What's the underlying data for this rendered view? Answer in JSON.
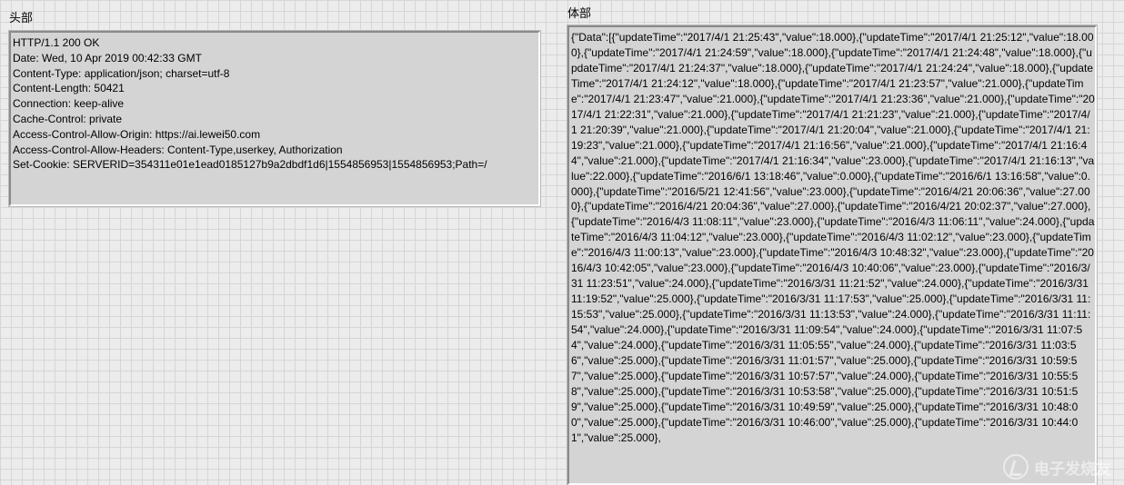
{
  "header_panel": {
    "label": "头部",
    "lines": [
      "HTTP/1.1 200 OK",
      "Date: Wed, 10 Apr 2019 00:42:33 GMT",
      "Content-Type: application/json; charset=utf-8",
      "Content-Length: 50421",
      "Connection: keep-alive",
      "Cache-Control: private",
      "Access-Control-Allow-Origin: https://ai.lewei50.com",
      "Access-Control-Allow-Headers: Content-Type,userkey, Authorization",
      "Set-Cookie: SERVERID=354311e01e1ead0185127b9a2dbdf1d6|1554856953|1554856953;Path=/"
    ]
  },
  "body_panel": {
    "label": "体部",
    "text": "{\"Data\":[{\"updateTime\":\"2017/4/1 21:25:43\",\"value\":18.000},{\"updateTime\":\"2017/4/1 21:25:12\",\"value\":18.000},{\"updateTime\":\"2017/4/1 21:24:59\",\"value\":18.000},{\"updateTime\":\"2017/4/1 21:24:48\",\"value\":18.000},{\"updateTime\":\"2017/4/1 21:24:37\",\"value\":18.000},{\"updateTime\":\"2017/4/1 21:24:24\",\"value\":18.000},{\"updateTime\":\"2017/4/1 21:24:12\",\"value\":18.000},{\"updateTime\":\"2017/4/1 21:23:57\",\"value\":21.000},{\"updateTime\":\"2017/4/1 21:23:47\",\"value\":21.000},{\"updateTime\":\"2017/4/1 21:23:36\",\"value\":21.000},{\"updateTime\":\"2017/4/1 21:22:31\",\"value\":21.000},{\"updateTime\":\"2017/4/1 21:21:23\",\"value\":21.000},{\"updateTime\":\"2017/4/1 21:20:39\",\"value\":21.000},{\"updateTime\":\"2017/4/1 21:20:04\",\"value\":21.000},{\"updateTime\":\"2017/4/1 21:19:23\",\"value\":21.000},{\"updateTime\":\"2017/4/1 21:16:56\",\"value\":21.000},{\"updateTime\":\"2017/4/1 21:16:44\",\"value\":21.000},{\"updateTime\":\"2017/4/1 21:16:34\",\"value\":23.000},{\"updateTime\":\"2017/4/1 21:16:13\",\"value\":22.000},{\"updateTime\":\"2016/6/1 13:18:46\",\"value\":0.000},{\"updateTime\":\"2016/6/1 13:16:58\",\"value\":0.000},{\"updateTime\":\"2016/5/21 12:41:56\",\"value\":23.000},{\"updateTime\":\"2016/4/21 20:06:36\",\"value\":27.000},{\"updateTime\":\"2016/4/21 20:04:36\",\"value\":27.000},{\"updateTime\":\"2016/4/21 20:02:37\",\"value\":27.000},{\"updateTime\":\"2016/4/3 11:08:11\",\"value\":23.000},{\"updateTime\":\"2016/4/3 11:06:11\",\"value\":24.000},{\"updateTime\":\"2016/4/3 11:04:12\",\"value\":23.000},{\"updateTime\":\"2016/4/3 11:02:12\",\"value\":23.000},{\"updateTime\":\"2016/4/3 11:00:13\",\"value\":23.000},{\"updateTime\":\"2016/4/3 10:48:32\",\"value\":23.000},{\"updateTime\":\"2016/4/3 10:42:05\",\"value\":23.000},{\"updateTime\":\"2016/4/3 10:40:06\",\"value\":23.000},{\"updateTime\":\"2016/3/31 11:23:51\",\"value\":24.000},{\"updateTime\":\"2016/3/31 11:21:52\",\"value\":24.000},{\"updateTime\":\"2016/3/31 11:19:52\",\"value\":25.000},{\"updateTime\":\"2016/3/31 11:17:53\",\"value\":25.000},{\"updateTime\":\"2016/3/31 11:15:53\",\"value\":25.000},{\"updateTime\":\"2016/3/31 11:13:53\",\"value\":24.000},{\"updateTime\":\"2016/3/31 11:11:54\",\"value\":24.000},{\"updateTime\":\"2016/3/31 11:09:54\",\"value\":24.000},{\"updateTime\":\"2016/3/31 11:07:54\",\"value\":24.000},{\"updateTime\":\"2016/3/31 11:05:55\",\"value\":24.000},{\"updateTime\":\"2016/3/31 11:03:56\",\"value\":25.000},{\"updateTime\":\"2016/3/31 11:01:57\",\"value\":25.000},{\"updateTime\":\"2016/3/31 10:59:57\",\"value\":25.000},{\"updateTime\":\"2016/3/31 10:57:57\",\"value\":24.000},{\"updateTime\":\"2016/3/31 10:55:58\",\"value\":25.000},{\"updateTime\":\"2016/3/31 10:53:58\",\"value\":25.000},{\"updateTime\":\"2016/3/31 10:51:59\",\"value\":25.000},{\"updateTime\":\"2016/3/31 10:49:59\",\"value\":25.000},{\"updateTime\":\"2016/3/31 10:48:00\",\"value\":25.000},{\"updateTime\":\"2016/3/31 10:46:00\",\"value\":25.000},{\"updateTime\":\"2016/3/31 10:44:01\",\"value\":25.000},"
  },
  "watermark": {
    "text": "电子发烧友",
    "logo_icon": "elecfans-logo-icon"
  }
}
